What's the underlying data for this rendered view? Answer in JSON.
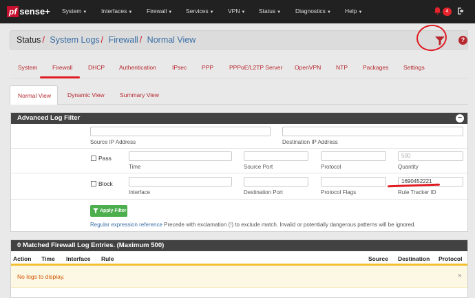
{
  "navbar": {
    "brand_pf": "pf",
    "brand_sense": "sense+",
    "items": [
      {
        "label": "System"
      },
      {
        "label": "Interfaces"
      },
      {
        "label": "Firewall"
      },
      {
        "label": "Services"
      },
      {
        "label": "VPN"
      },
      {
        "label": "Status"
      },
      {
        "label": "Diagnostics"
      },
      {
        "label": "Help"
      }
    ],
    "notification_count": "4"
  },
  "breadcrumb": {
    "items": [
      "Status",
      "System Logs",
      "Firewall",
      "Normal View"
    ]
  },
  "tabs": [
    "System",
    "Firewall",
    "DHCP",
    "Authentication",
    "IPsec",
    "PPP",
    "PPPoE/L2TP Server",
    "OpenVPN",
    "NTP",
    "Packages",
    "Settings"
  ],
  "subtabs": [
    "Normal View",
    "Dynamic View",
    "Summary View"
  ],
  "filter_panel": {
    "title": "Advanced Log Filter",
    "labels": {
      "source_ip": "Source IP Address",
      "dest_ip": "Destination IP Address",
      "time": "Time",
      "source_port": "Source Port",
      "protocol": "Protocol",
      "quantity": "Quantity",
      "interface": "Interface",
      "dest_port": "Destination Port",
      "protocol_flags": "Protocol Flags",
      "rule_tracker": "Rule Tracker ID"
    },
    "quantity_placeholder": "500",
    "rule_tracker_value": "1690452221",
    "pass_label": "Pass",
    "block_label": "Block",
    "apply_label": "Apply Filter",
    "help_link": "Regular expression reference",
    "help_text": " Precede with exclamation (!) to exclude match. Invalid or potentially dangerous patterns will be ignored."
  },
  "log_panel": {
    "title": "0 Matched Firewall Log Entries. (Maximum 500)",
    "columns": [
      "Action",
      "Time",
      "Interface",
      "Rule",
      "Source",
      "Destination",
      "Protocol"
    ],
    "empty_message": "No logs to display."
  },
  "colors": {
    "navbar": "#212121",
    "accent": "#b7282e",
    "link": "#3a6ea5",
    "success": "#4cae4c",
    "warning_text": "#d35400",
    "annotation": "#e01b22"
  }
}
